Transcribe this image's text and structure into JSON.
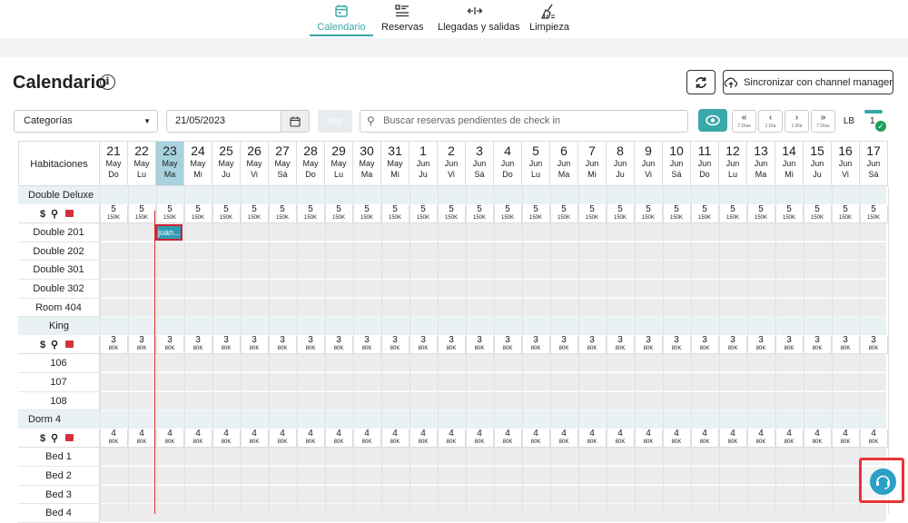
{
  "nav": {
    "tabs": [
      {
        "label": "Calendario",
        "icon": "calendar-icon",
        "active": true
      },
      {
        "label": "Reservas",
        "icon": "list-icon",
        "active": false
      },
      {
        "label": "Llegadas y salidas",
        "icon": "arrows-icon",
        "active": false
      },
      {
        "label": "Limpieza",
        "icon": "broom-icon",
        "active": false
      }
    ]
  },
  "page": {
    "title": "Calendario",
    "sync_label": "Sincronizar con channel manager"
  },
  "filters": {
    "category_value": "Categorías",
    "date_value": "21/05/2023",
    "today_label": "Hoy",
    "search_placeholder": "Buscar reservas pendientes de check in",
    "nav_buttons": [
      {
        "arrow": "«",
        "sub": "7 Días"
      },
      {
        "arrow": "‹",
        "sub": "1 Día"
      },
      {
        "arrow": "›",
        "sub": "1 Día"
      },
      {
        "arrow": "»",
        "sub": "7 Días"
      }
    ],
    "lb_label": "LB",
    "count": "1"
  },
  "calendar": {
    "rooms_header": "Habitaciones",
    "days": [
      {
        "d": "21",
        "m": "May",
        "w": "Do"
      },
      {
        "d": "22",
        "m": "May",
        "w": "Lu"
      },
      {
        "d": "23",
        "m": "May",
        "w": "Ma",
        "today": true
      },
      {
        "d": "24",
        "m": "May",
        "w": "Mi"
      },
      {
        "d": "25",
        "m": "May",
        "w": "Ju"
      },
      {
        "d": "26",
        "m": "May",
        "w": "Vi"
      },
      {
        "d": "27",
        "m": "May",
        "w": "Sá"
      },
      {
        "d": "28",
        "m": "May",
        "w": "Do"
      },
      {
        "d": "29",
        "m": "May",
        "w": "Lu"
      },
      {
        "d": "30",
        "m": "May",
        "w": "Ma"
      },
      {
        "d": "31",
        "m": "May",
        "w": "Mi"
      },
      {
        "d": "1",
        "m": "Jun",
        "w": "Ju"
      },
      {
        "d": "2",
        "m": "Jun",
        "w": "Vi"
      },
      {
        "d": "3",
        "m": "Jun",
        "w": "Sá"
      },
      {
        "d": "4",
        "m": "Jun",
        "w": "Do"
      },
      {
        "d": "5",
        "m": "Jun",
        "w": "Lu"
      },
      {
        "d": "6",
        "m": "Jun",
        "w": "Ma"
      },
      {
        "d": "7",
        "m": "Jun",
        "w": "Mi"
      },
      {
        "d": "8",
        "m": "Jun",
        "w": "Ju"
      },
      {
        "d": "9",
        "m": "Jun",
        "w": "Vi"
      },
      {
        "d": "10",
        "m": "Jun",
        "w": "Sá"
      },
      {
        "d": "11",
        "m": "Jun",
        "w": "Do"
      },
      {
        "d": "12",
        "m": "Jun",
        "w": "Lu"
      },
      {
        "d": "13",
        "m": "Jun",
        "w": "Ma"
      },
      {
        "d": "14",
        "m": "Jun",
        "w": "Mi"
      },
      {
        "d": "15",
        "m": "Jun",
        "w": "Ju"
      },
      {
        "d": "16",
        "m": "Jun",
        "w": "Vi"
      },
      {
        "d": "17",
        "m": "Jun",
        "w": "Sá"
      }
    ],
    "groups": [
      {
        "name": "Double Deluxe",
        "avail": "5",
        "price": "150K",
        "rooms": [
          "Double 201",
          "Double 202",
          "Double 301",
          "Double 302",
          "Room 404"
        ],
        "align": "left"
      },
      {
        "name": "King",
        "avail": "3",
        "price": "80K",
        "rooms": [
          "106",
          "107",
          "108"
        ],
        "align": "center"
      },
      {
        "name": "Dorm 4",
        "avail": "4",
        "price": "80K",
        "rooms": [
          "Bed 1",
          "Bed 2",
          "Bed 3",
          "Bed 4"
        ],
        "align": "left"
      }
    ],
    "avail_symbols": "$ 🔍 🔒",
    "booking": {
      "guest": "juan..."
    }
  },
  "colors": {
    "accent": "#3aa8a8",
    "today": "#a7d2de",
    "booking": "#2e9bb5",
    "highlight": "#e8333a"
  }
}
